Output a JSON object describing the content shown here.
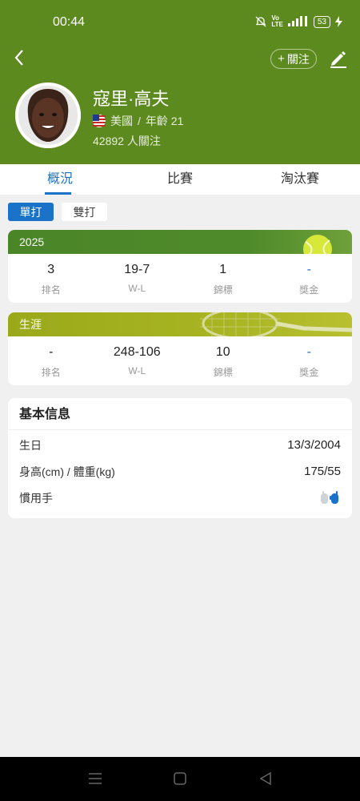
{
  "status_bar": {
    "time": "00:44",
    "icons": [
      "mute-icon",
      "volte-icon",
      "signal-icon"
    ],
    "battery": "53"
  },
  "header": {
    "follow_label": "關注",
    "player_name": "寇里·高夫",
    "country": "美國",
    "age_text": "年齡 21",
    "followers": "42892 人關注",
    "colors": {
      "header_bg": "#5c8a1e",
      "accent": "#1a73c8"
    }
  },
  "tabs": [
    {
      "label": "概況",
      "active": true
    },
    {
      "label": "比賽",
      "active": false
    },
    {
      "label": "淘汰賽",
      "active": false
    }
  ],
  "type_toggle": {
    "single": "單打",
    "double": "雙打",
    "selected": "單打"
  },
  "season_card": {
    "title": "2025",
    "stats": [
      {
        "value": "3",
        "label": "排名"
      },
      {
        "value": "19-7",
        "label": "W-L"
      },
      {
        "value": "1",
        "label": "錦標"
      },
      {
        "value": "-",
        "label": "獎金"
      }
    ]
  },
  "career_card": {
    "title": "生涯",
    "stats": [
      {
        "value": "-",
        "label": "排名"
      },
      {
        "value": "248-106",
        "label": "W-L"
      },
      {
        "value": "10",
        "label": "錦標"
      },
      {
        "value": "-",
        "label": "獎金"
      }
    ]
  },
  "basic_info": {
    "title": "基本信息",
    "rows": [
      {
        "label": "生日",
        "value": "13/3/2004"
      },
      {
        "label": "身高(cm) / 體重(kg)",
        "value": "175/55"
      },
      {
        "label": "慣用手",
        "value_icon": "right-hand-icon"
      }
    ]
  },
  "nav": {
    "buttons": [
      "menu-icon",
      "home-icon",
      "back-icon"
    ]
  }
}
